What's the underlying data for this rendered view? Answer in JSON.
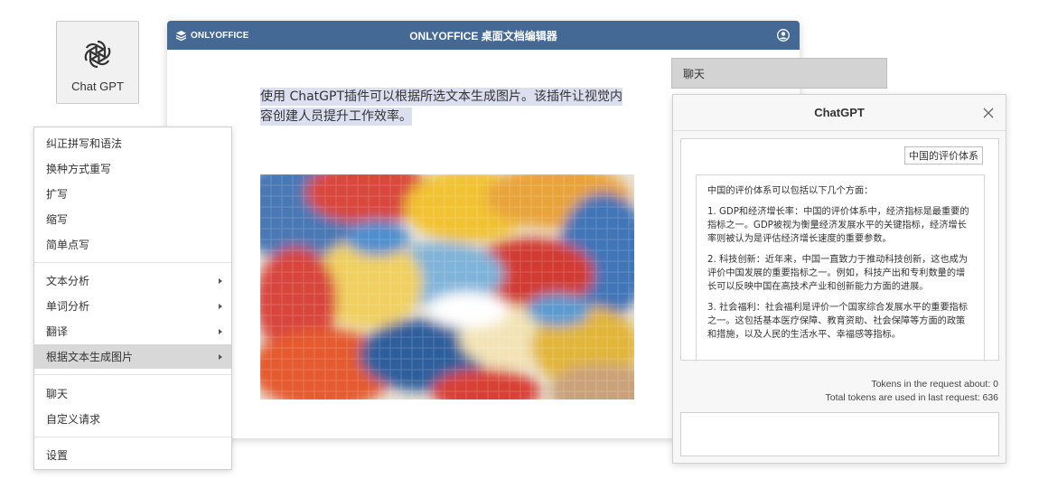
{
  "plugin_button": {
    "label": "Chat GPT",
    "icon": "chatgpt-logo-icon"
  },
  "editor": {
    "brand": "ONLYOFFICE",
    "title": "ONLYOFFICE 桌面文档编辑器",
    "selected_text": "使用 ChatGPT插件可以根据所选文本生成图片。该插件让视觉内容创建人员提升工作效率。",
    "user_icon": "user-avatar-icon",
    "image": "generated-abstract-painting"
  },
  "context_menu": {
    "items": [
      {
        "label": "纠正拼写和语法",
        "submenu": false
      },
      {
        "label": "换种方式重写",
        "submenu": false
      },
      {
        "label": "扩写",
        "submenu": false
      },
      {
        "label": "缩写",
        "submenu": false
      },
      {
        "label": "简单点写",
        "submenu": false
      },
      {
        "label": "文本分析",
        "submenu": true
      },
      {
        "label": "单词分析",
        "submenu": true
      },
      {
        "label": "翻译",
        "submenu": true
      },
      {
        "label": "根据文本生成图片",
        "submenu": true,
        "active": true
      },
      {
        "label": "聊天",
        "submenu": false
      },
      {
        "label": "自定义请求",
        "submenu": false
      },
      {
        "label": "设置",
        "submenu": false
      }
    ]
  },
  "chat_tab": {
    "label": "聊天"
  },
  "chat_panel": {
    "title": "ChatGPT",
    "user_message": "中国的评价体系",
    "answer": {
      "intro": "中国的评价体系可以包括以下几个方面：",
      "points": [
        "1. GDP和经济增长率：中国的评价体系中，经济指标是最重要的指标之一。GDP被视为衡量经济发展水平的关键指标，经济增长率则被认为是评估经济增长速度的重要参数。",
        "2. 科技创新：近年来，中国一直致力于推动科技创新，这也成为评价中国发展的重要指标之一。例如，科技产出和专利数量的增长可以反映中国在高技术产业和创新能力方面的进展。",
        "3. 社会福利：社会福利是评价一个国家综合发展水平的重要指标之一。这包括基本医疗保障、教育资助、社会保障等方面的政策和措施，以及人民的生活水平、幸福感等指标。"
      ]
    },
    "tokens_request": "Tokens in the request about: 0",
    "tokens_total": "Total tokens are used in last request: 636",
    "input_value": ""
  },
  "colors": {
    "titlebar": "#446995",
    "selection": "#dcdff0",
    "menu_active": "#d8d8d8",
    "chat_tab": "#d3d3d3"
  }
}
